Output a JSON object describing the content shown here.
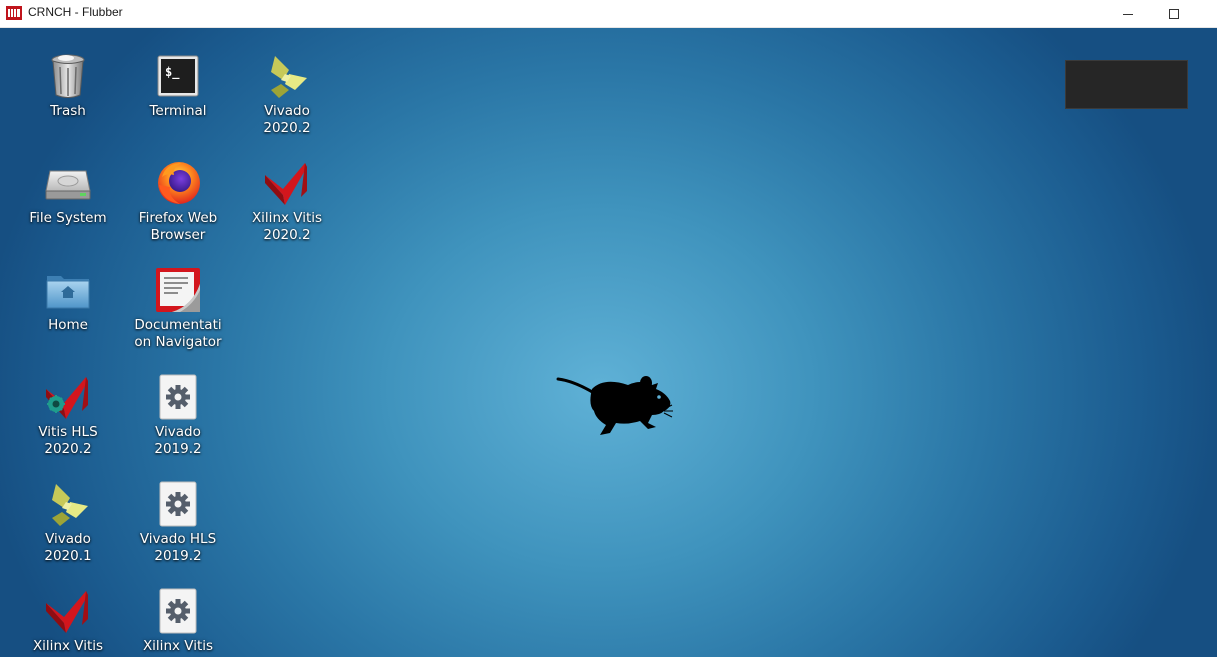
{
  "window": {
    "title": "CRNCH - Flubber",
    "app_icon": "flubber-app-icon",
    "minimize_icon": "minimize-icon",
    "maximize_icon": "maximize-icon"
  },
  "desktop": {
    "background_color": "#3f93bd",
    "icons": [
      {
        "label": "Trash",
        "icon": "trash-icon"
      },
      {
        "label": "Terminal",
        "icon": "terminal-icon"
      },
      {
        "label": "Vivado\n2020.2",
        "icon": "vivado-icon"
      },
      {
        "label": "File System",
        "icon": "harddrive-icon"
      },
      {
        "label": "Firefox Web\nBrowser",
        "icon": "firefox-icon"
      },
      {
        "label": "Xilinx Vitis\n2020.2",
        "icon": "vitis-icon"
      },
      {
        "label": "Home",
        "icon": "home-folder-icon"
      },
      {
        "label": "Documentati\non Navigator",
        "icon": "doc-navigator-icon"
      },
      {
        "label": "Vitis HLS\n2020.2",
        "icon": "vitis-hls-icon"
      },
      {
        "label": "Vivado\n2019.2",
        "icon": "gear-icon"
      },
      {
        "label": "Vivado\n2020.1",
        "icon": "vivado-icon"
      },
      {
        "label": "Vivado HLS\n2019.2",
        "icon": "gear-icon"
      },
      {
        "label": "Xilinx Vitis",
        "icon": "vitis-icon"
      },
      {
        "label": "Xilinx Vitis",
        "icon": "gear-icon"
      }
    ],
    "panel_widget": "dark-panel-widget",
    "wallpaper_logo": "xfce-mouse-icon"
  }
}
